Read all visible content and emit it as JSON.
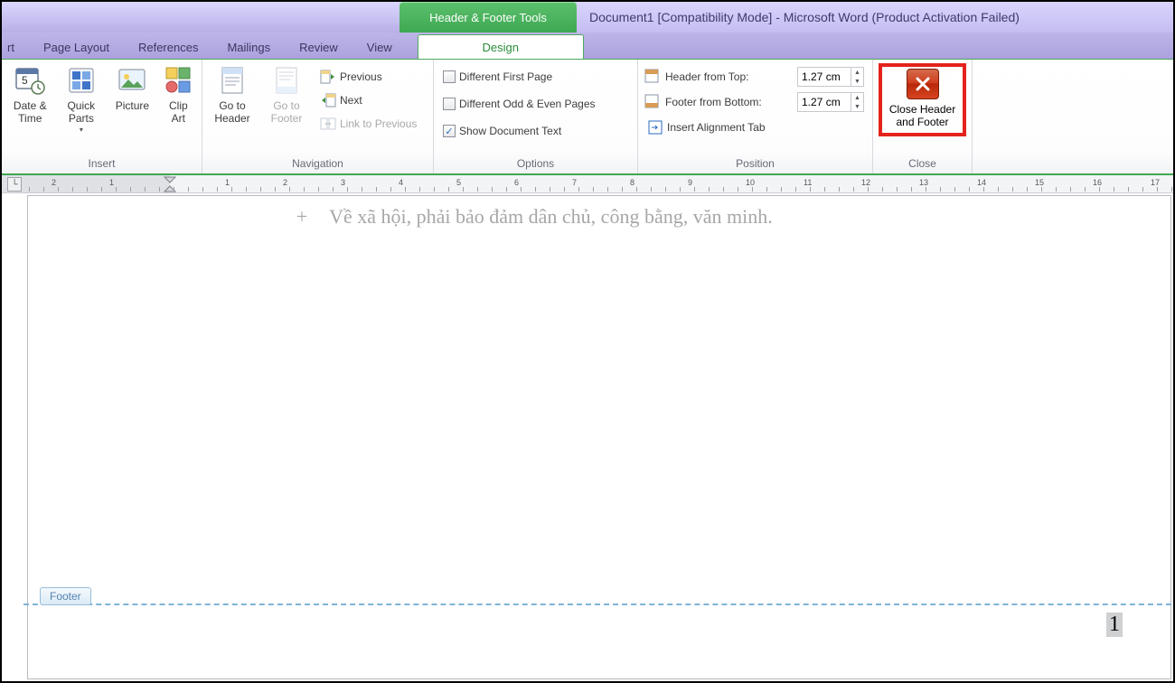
{
  "title": {
    "context_tool": "Header & Footer Tools",
    "doc_title": "Document1 [Compatibility Mode] - Microsoft Word (Product Activation Failed)"
  },
  "tabs": {
    "t0": "rt",
    "t1": "Page Layout",
    "t2": "References",
    "t3": "Mailings",
    "t4": "Review",
    "t5": "View",
    "design": "Design"
  },
  "groups": {
    "insert": {
      "label": "Insert",
      "datetime": "Date & Time",
      "quickparts": "Quick Parts",
      "picture": "Picture",
      "clipart": "Clip Art"
    },
    "navigation": {
      "label": "Navigation",
      "gotoheader": "Go to Header",
      "gotofooter": "Go to Footer",
      "previous": "Previous",
      "next": "Next",
      "linkprevious": "Link to Previous"
    },
    "options": {
      "label": "Options",
      "diff_first": "Different First Page",
      "diff_oddeven": "Different Odd & Even Pages",
      "show_doc": "Show Document Text"
    },
    "position": {
      "label": "Position",
      "header_top": "Header from Top:",
      "footer_bottom": "Footer from Bottom:",
      "header_val": "1.27 cm",
      "footer_val": "1.27 cm",
      "align_tab": "Insert Alignment Tab"
    },
    "close": {
      "label": "Close",
      "close_hf": "Close Header and Footer"
    }
  },
  "ruler": {
    "nums": [
      "2",
      "1",
      "1",
      "2",
      "3",
      "4",
      "5",
      "6",
      "7",
      "8",
      "9",
      "10",
      "11",
      "12",
      "13",
      "14",
      "15",
      "16",
      "17"
    ]
  },
  "doc": {
    "body_text": "Về xã hội, phải bảo đảm dân chủ, công bằng, văn minh.",
    "footer_tab": "Footer",
    "page_number": "1"
  }
}
